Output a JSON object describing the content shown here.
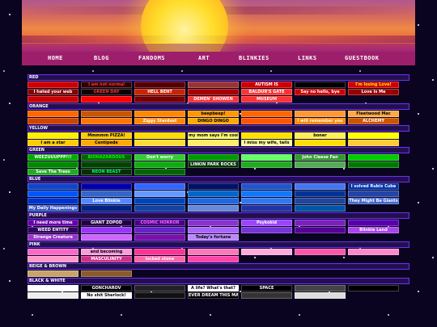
{
  "nav": {
    "items": [
      "HOME",
      "BLOG",
      "FANDOMS",
      "ART",
      "BLINKIES",
      "LINKS",
      "GUESTBOOK"
    ]
  },
  "sections": [
    {
      "name": "RED",
      "rows": [
        [
          {
            "text": "",
            "bg": "#cc0000",
            "fg": "#ffffff"
          },
          {
            "text": "I am not normal",
            "bg": "#2a0000",
            "fg": "#ff3333"
          },
          {
            "text": "",
            "bg": "#550000",
            "fg": "#ffffff"
          },
          {
            "text": "",
            "bg": "#993333",
            "fg": "#ffffff"
          },
          {
            "text": "AUTISM IS",
            "bg": "#cc0000",
            "fg": "#ffffff"
          },
          {
            "text": "",
            "bg": "#000000",
            "fg": "#ff0000"
          },
          {
            "text": "I'm losing Love!",
            "bg": "#cc0000",
            "fg": "#ffee00"
          }
        ],
        [
          {
            "text": "I hated your web",
            "bg": "#880000",
            "fg": "#ffffff"
          },
          {
            "text": "GREEN DAY",
            "bg": "#110000",
            "fg": "#ff3333"
          },
          {
            "text": "HELL BENT",
            "bg": "#cc2200",
            "fg": "#ffffff"
          },
          {
            "text": "",
            "bg": "#aa0000",
            "fg": "#ffffff"
          },
          {
            "text": "BALDUR'S GATE",
            "bg": "#ff3333",
            "fg": "#ffffff"
          },
          {
            "text": "Say no hello, bye",
            "bg": "#cc0000",
            "fg": "#ffffff"
          },
          {
            "text": "Love Is Me",
            "bg": "#990000",
            "fg": "#ffffff"
          }
        ],
        [
          {
            "text": "",
            "bg": "#cc0000",
            "fg": "#ffffff"
          },
          {
            "text": "",
            "bg": "#ff0000",
            "fg": "#ffffff"
          },
          {
            "text": "",
            "bg": "#770000",
            "fg": "#ffffff"
          },
          {
            "text": "DEMEN' SHOWEN",
            "bg": "#ff3333",
            "fg": "#ffffff"
          },
          {
            "text": "MUSEUM",
            "bg": "#ff3333",
            "fg": "#ffffff"
          }
        ]
      ]
    },
    {
      "name": "ORANGE",
      "rows": [
        [
          {
            "text": "",
            "bg": "#ff6600",
            "fg": "#ffffff"
          },
          {
            "text": "",
            "bg": "#cc5500",
            "fg": "#ffffff"
          },
          {
            "text": "",
            "bg": "#ff8800",
            "fg": "#ffffff"
          },
          {
            "text": "beepbeep!",
            "bg": "#ff9900",
            "fg": "#000000"
          },
          {
            "text": "",
            "bg": "#ff6600",
            "fg": "#ffffff"
          },
          {
            "text": "",
            "bg": "#ff9933",
            "fg": "#ffffff"
          },
          {
            "text": "Fleetwood Mac",
            "bg": "#ffaa44",
            "fg": "#000000"
          }
        ],
        [
          {
            "text": "",
            "bg": "#cc4400",
            "fg": "#ffffff"
          },
          {
            "text": "",
            "bg": "#ff7700",
            "fg": "#ffffff"
          },
          {
            "text": "Ziggy Stardust",
            "bg": "#ff8800",
            "fg": "#ffffff"
          },
          {
            "text": "DINGO DINGO",
            "bg": "#ffaa00",
            "fg": "#000000"
          },
          {
            "text": "",
            "bg": "#ff5500",
            "fg": "#ffffff"
          },
          {
            "text": "I will remember you",
            "bg": "#ff8800",
            "fg": "#ffffff"
          },
          {
            "text": "ALCHEMY",
            "bg": "#cc5500",
            "fg": "#ffffff"
          }
        ]
      ]
    },
    {
      "name": "YELLOW",
      "rows": [
        [
          {
            "text": "",
            "bg": "#ffee00",
            "fg": "#000000"
          },
          {
            "text": "Mmmmm PIZZA!",
            "bg": "#ffcc00",
            "fg": "#000000"
          },
          {
            "text": "",
            "bg": "#ffdd00",
            "fg": "#000000"
          },
          {
            "text": "my mom says I'm cool",
            "bg": "#ffff66",
            "fg": "#000000"
          },
          {
            "text": "",
            "bg": "#ffe100",
            "fg": "#000000"
          },
          {
            "text": "boner",
            "bg": "#ffee55",
            "fg": "#000000"
          },
          {
            "text": "",
            "bg": "#ffff00",
            "fg": "#000000"
          }
        ],
        [
          {
            "text": "I am a star",
            "bg": "#ffcc00",
            "fg": "#000000"
          },
          {
            "text": "Centipede",
            "bg": "#ffaa00",
            "fg": "#000000"
          },
          {
            "text": "",
            "bg": "#ffdd33",
            "fg": "#000000"
          },
          {
            "text": "",
            "bg": "#ffee66",
            "fg": "#000000"
          },
          {
            "text": "I miss my wife, tails",
            "bg": "#ffff99",
            "fg": "#000000"
          },
          {
            "text": "",
            "bg": "#ffdd00",
            "fg": "#000000"
          },
          {
            "text": "",
            "bg": "#ffcc33",
            "fg": "#000000"
          }
        ]
      ]
    },
    {
      "name": "GREEN",
      "rows": [
        [
          {
            "text": "WEEZUUUPPP!!!",
            "bg": "#00aa00",
            "fg": "#ffffff"
          },
          {
            "text": "BIOHAZARDOUS",
            "bg": "#006600",
            "fg": "#00ff00"
          },
          {
            "text": "Don't worry",
            "bg": "#33cc33",
            "fg": "#ffffff"
          },
          {
            "text": "",
            "bg": "#009900",
            "fg": "#ffffff"
          },
          {
            "text": "",
            "bg": "#66ff66",
            "fg": "#000000"
          },
          {
            "text": "John Cleese Fan",
            "bg": "#339933",
            "fg": "#ffffff"
          },
          {
            "text": "",
            "bg": "#00cc00",
            "fg": "#000000"
          }
        ],
        [
          {
            "text": "",
            "bg": "#008800",
            "fg": "#ffffff"
          },
          {
            "text": "",
            "bg": "#004400",
            "fg": "#ffffff"
          },
          {
            "text": "",
            "bg": "#11aa11",
            "fg": "#ffffff"
          },
          {
            "text": "LINKIN PARK ROCKS",
            "bg": "#003300",
            "fg": "#ffffff"
          },
          {
            "text": "",
            "bg": "#22aa22",
            "fg": "#ffffff"
          },
          {
            "text": "",
            "bg": "#55aa55",
            "fg": "#ffffff"
          },
          {
            "text": "",
            "bg": "#007700",
            "fg": "#ffffff"
          }
        ],
        [
          {
            "text": "Save The Trees",
            "bg": "#22aa22",
            "fg": "#ffffff"
          },
          {
            "text": "NEON BEAST",
            "bg": "#003300",
            "fg": "#00ff66"
          },
          {
            "text": "",
            "bg": "#006600",
            "fg": "#ffffff"
          }
        ]
      ]
    },
    {
      "name": "BLUE",
      "rows": [
        [
          {
            "text": "",
            "bg": "#1144cc",
            "fg": "#ffffff"
          },
          {
            "text": "",
            "bg": "#0000aa",
            "fg": "#ffffff"
          },
          {
            "text": "",
            "bg": "#3366ff",
            "fg": "#ffffff"
          },
          {
            "text": "",
            "bg": "#001166",
            "fg": "#ffffff"
          },
          {
            "text": "",
            "bg": "#2255cc",
            "fg": "#ffffff"
          },
          {
            "text": "",
            "bg": "#4477ee",
            "fg": "#ffffff"
          },
          {
            "text": "I solved Rubix Cube",
            "bg": "#0033aa",
            "fg": "#ffffff"
          }
        ],
        [
          {
            "text": "",
            "bg": "#0055ff",
            "fg": "#ffffff"
          },
          {
            "text": "",
            "bg": "#3366cc",
            "fg": "#ffffff"
          },
          {
            "text": "",
            "bg": "#6699ff",
            "fg": "#ffffff"
          },
          {
            "text": "",
            "bg": "#0066cc",
            "fg": "#ffffff"
          },
          {
            "text": "",
            "bg": "#1177ff",
            "fg": "#ffffff"
          },
          {
            "text": "",
            "bg": "#003399",
            "fg": "#ffffff"
          },
          {
            "text": "",
            "bg": "#2244aa",
            "fg": "#ffffff"
          }
        ],
        [
          {
            "text": "",
            "bg": "#0033cc",
            "fg": "#ffffff"
          },
          {
            "text": "Love Blinkie",
            "bg": "#5588ff",
            "fg": "#ffffff"
          },
          {
            "text": "",
            "bg": "#0044bb",
            "fg": "#ffffff"
          },
          {
            "text": "",
            "bg": "#2266dd",
            "fg": "#ffffff"
          },
          {
            "text": "",
            "bg": "#3377ee",
            "fg": "#ffffff"
          },
          {
            "text": "",
            "bg": "#224499",
            "fg": "#ffffff"
          },
          {
            "text": "They Might Be Giants",
            "bg": "#4466cc",
            "fg": "#ffffff"
          }
        ],
        [
          {
            "text": "My Daily Happenings",
            "bg": "#3355cc",
            "fg": "#ffffff"
          },
          {
            "text": "",
            "bg": "#002288",
            "fg": "#ffffff"
          },
          {
            "text": "",
            "bg": "#1144aa",
            "fg": "#ffffff"
          },
          {
            "text": "",
            "bg": "#6688dd",
            "fg": "#ffffff"
          },
          {
            "text": "",
            "bg": "#2233aa",
            "fg": "#ffffff"
          },
          {
            "text": "",
            "bg": "#0055aa",
            "fg": "#ffffff"
          }
        ]
      ]
    },
    {
      "name": "PURPLE",
      "rows": [
        [
          {
            "text": "I need more time",
            "bg": "#6600aa",
            "fg": "#ffffff"
          },
          {
            "text": "GIANT ZOPOD",
            "bg": "#220044",
            "fg": "#ffffff"
          },
          {
            "text": "COSMIC HORROR",
            "bg": "#440088",
            "fg": "#ff66ff"
          },
          {
            "text": "",
            "bg": "#8833cc",
            "fg": "#ffffff"
          },
          {
            "text": "Psykokid",
            "bg": "#9944ff",
            "fg": "#ffffff"
          },
          {
            "text": "",
            "bg": "#7722bb",
            "fg": "#ffffff"
          },
          {
            "text": "",
            "bg": "#5500aa",
            "fg": "#ffffff"
          }
        ],
        [
          {
            "text": "WEED ENTITY",
            "bg": "#330066",
            "fg": "#ffffff"
          },
          {
            "text": "",
            "bg": "#9933ff",
            "fg": "#ffffff"
          },
          {
            "text": "",
            "bg": "#6622cc",
            "fg": "#ffffff"
          },
          {
            "text": "",
            "bg": "#aa66ff",
            "fg": "#ffffff"
          },
          {
            "text": "",
            "bg": "#7733dd",
            "fg": "#ffffff"
          },
          {
            "text": "",
            "bg": "#550099",
            "fg": "#ffffff"
          },
          {
            "text": "Blinkie Land",
            "bg": "#aa44ee",
            "fg": "#ffffff"
          }
        ],
        [
          {
            "text": "Strange Creature",
            "bg": "#9933cc",
            "fg": "#ffffff"
          },
          {
            "text": "",
            "bg": "#cc66ff",
            "fg": "#ffffff"
          },
          {
            "text": "",
            "bg": "#7711aa",
            "fg": "#ffffff"
          },
          {
            "text": "Today's fortune",
            "bg": "#bb88ff",
            "fg": "#000000"
          }
        ]
      ]
    },
    {
      "name": "PINK",
      "rows": [
        [
          {
            "text": "",
            "bg": "#ff66cc",
            "fg": "#ffffff"
          },
          {
            "text": "and becoming",
            "bg": "#ff99dd",
            "fg": "#000000"
          },
          {
            "text": "",
            "bg": "#ff3399",
            "fg": "#ffffff"
          },
          {
            "text": "",
            "bg": "#ff77bb",
            "fg": "#ffffff"
          },
          {
            "text": "",
            "bg": "#ffaadd",
            "fg": "#000000"
          },
          {
            "text": "",
            "bg": "#ff55aa",
            "fg": "#ffffff"
          },
          {
            "text": "",
            "bg": "#ff88cc",
            "fg": "#ffffff"
          }
        ],
        [
          {
            "text": "",
            "bg": "#ff99cc",
            "fg": "#ffffff"
          },
          {
            "text": "MASCULINITY",
            "bg": "#cc3388",
            "fg": "#ffffff"
          },
          {
            "text": "locked stone",
            "bg": "#ff66aa",
            "fg": "#ffffff"
          },
          {
            "text": "",
            "bg": "#ff44aa",
            "fg": "#ffffff"
          }
        ]
      ]
    },
    {
      "name": "BEIGE & BROWN",
      "rows": [
        [
          {
            "text": "",
            "bg": "#c8a46a",
            "fg": "#000000"
          },
          {
            "text": "",
            "bg": "#8b5a2b",
            "fg": "#ffffff"
          }
        ]
      ]
    },
    {
      "name": "BLACK & WHITE",
      "rows": [
        [
          {
            "text": "",
            "bg": "#ffffff",
            "fg": "#000000"
          },
          {
            "text": "GONCHAROV",
            "bg": "#000000",
            "fg": "#ffffff"
          },
          {
            "text": "",
            "bg": "#222222",
            "fg": "#ffffff"
          },
          {
            "text": "A life? What's that?",
            "bg": "#ffffff",
            "fg": "#000000"
          },
          {
            "text": "SPACE",
            "bg": "#000000",
            "fg": "#ffffff"
          },
          {
            "text": "",
            "bg": "#444444",
            "fg": "#ffffff"
          },
          {
            "text": "",
            "bg": "#000000",
            "fg": "#ffffff"
          }
        ],
        [
          {
            "text": "",
            "bg": "#eeeeee",
            "fg": "#000000"
          },
          {
            "text": "No shit Sherlock!",
            "bg": "#ffffff",
            "fg": "#000000"
          },
          {
            "text": "",
            "bg": "#111111",
            "fg": "#ffffff"
          },
          {
            "text": "EVER DREAM THIS MAN?",
            "bg": "#000000",
            "fg": "#ffffff"
          },
          {
            "text": "",
            "bg": "#333333",
            "fg": "#ffffff"
          },
          {
            "text": "",
            "bg": "#dddddd",
            "fg": "#000000"
          }
        ]
      ]
    }
  ]
}
